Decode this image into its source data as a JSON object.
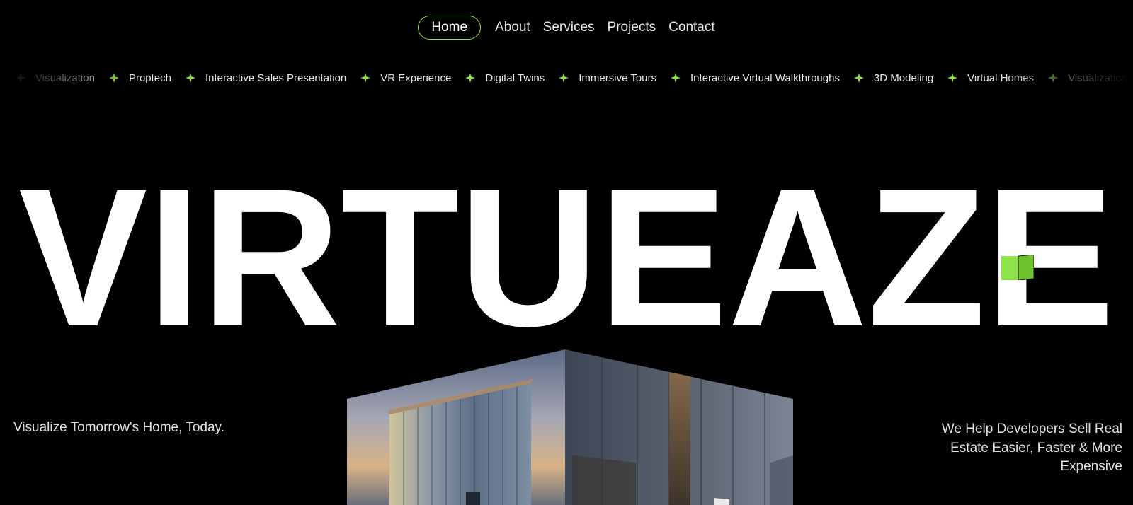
{
  "nav": {
    "items": [
      {
        "label": "Home",
        "active": true
      },
      {
        "label": "About",
        "active": false
      },
      {
        "label": "Services",
        "active": false
      },
      {
        "label": "Projects",
        "active": false
      },
      {
        "label": "Contact",
        "active": false
      }
    ],
    "accent_color": "#8fe34a"
  },
  "ticker": {
    "icon": "four-point-star-icon",
    "star_color": "#8fe34a",
    "items": [
      "Visualization",
      "Proptech",
      "Interactive Sales Presentation",
      "VR Experience",
      "Digital Twins",
      "Immersive Tours",
      "Interactive Virtual Walkthroughs",
      "3D Modeling",
      "Virtual Homes",
      "Visualization"
    ]
  },
  "hero": {
    "title": "VIRTUEAZE",
    "accent_icon": "green-cube-icon",
    "accent_color": "#8fe34a"
  },
  "taglines": {
    "left": "Visualize Tomorrow's Home, Today.",
    "right": "We Help Developers Sell Real Estate Easier, Faster & More Expensive"
  }
}
